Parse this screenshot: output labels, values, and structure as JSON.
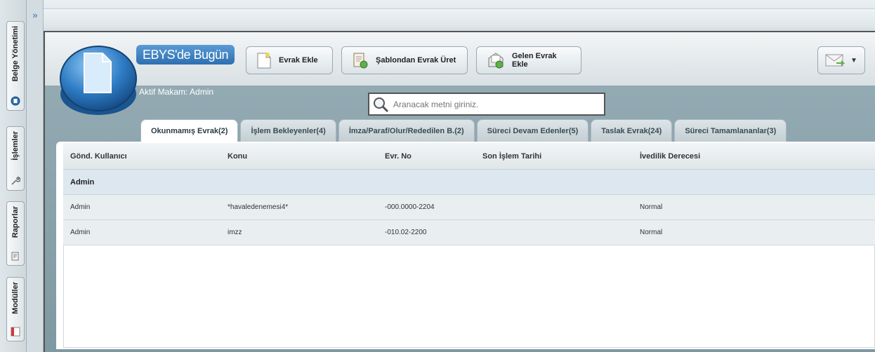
{
  "left_nav": {
    "items": [
      {
        "label": "Belge Yönetimi",
        "icon": "document-manager-icon"
      },
      {
        "label": "İşlemler",
        "icon": "wrench-icon"
      },
      {
        "label": "Raporlar",
        "icon": "report-icon"
      },
      {
        "label": "Modüller",
        "icon": "module-icon"
      }
    ],
    "collapse_glyph": "»"
  },
  "header": {
    "title": "EBYS'de Bugün",
    "makam": "Aktif Makam: Admin",
    "buttons": [
      {
        "label": "Evrak Ekle",
        "icon": "new-document-icon"
      },
      {
        "label": "Şablondan Evrak Üret",
        "icon": "template-document-icon"
      },
      {
        "label": "Gelen Evrak Ekle",
        "icon": "incoming-document-icon"
      }
    ],
    "mail_button_icon": "mail-icon"
  },
  "search": {
    "placeholder": "Aranacak metni giriniz."
  },
  "tabs": [
    {
      "label": "Okunmamış Evrak(2)",
      "active": true
    },
    {
      "label": "İşlem Bekleyenler(4)",
      "active": false
    },
    {
      "label": "İmza/Paraf/Olur/Rededilen B.(2)",
      "active": false
    },
    {
      "label": "Süreci Devam Edenler(5)",
      "active": false
    },
    {
      "label": "Taslak Evrak(24)",
      "active": false
    },
    {
      "label": "Süreci Tamamlananlar(3)",
      "active": false
    }
  ],
  "table": {
    "columns": [
      "Gönd. Kullanıcı",
      "Konu",
      "Evr. No",
      "Son İşlem Tarihi",
      "İvedilik Derecesi"
    ],
    "group": "Admin",
    "rows": [
      [
        "Admin",
        "*havaledenemesi4*",
        "-000.0000-2204",
        "",
        "Normal"
      ],
      [
        "Admin",
        "imzz",
        "-010.02-2200",
        "",
        "Normal"
      ]
    ]
  },
  "colors": {
    "accent": "#2d6fb0",
    "band": "#8aa3ad"
  }
}
